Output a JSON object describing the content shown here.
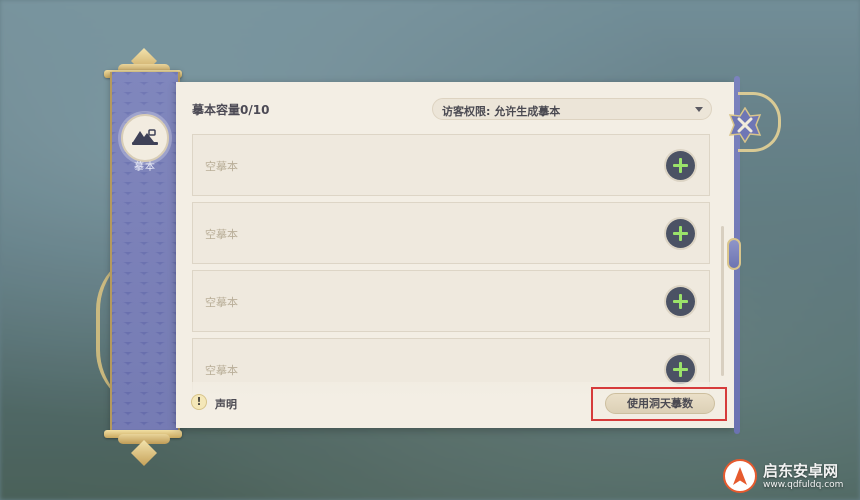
{
  "sidebar": {
    "tab_label": "摹本",
    "tab_icon": "blueprint-icon"
  },
  "header": {
    "capacity_label": "摹本容量0/10",
    "visitor_permission": "访客权限: 允许生成摹本"
  },
  "slots": [
    {
      "label": "空摹本",
      "action_icon": "plus-icon"
    },
    {
      "label": "空摹本",
      "action_icon": "plus-icon"
    },
    {
      "label": "空摹本",
      "action_icon": "plus-icon"
    },
    {
      "label": "空摹本",
      "action_icon": "plus-icon"
    }
  ],
  "footer": {
    "notice_icon": "!",
    "notice_label": "声明",
    "use_button_label": "使用洞天摹数"
  },
  "close_icon": "close-icon",
  "watermark": {
    "title": "启东安卓网",
    "url": "www.qdfuldq.com"
  },
  "colors": {
    "rod": "#6b72b1",
    "panel": "#f3eee4",
    "plus": "#9be36a",
    "highlight": "#d63b3b",
    "gold": "#c9a85f"
  }
}
